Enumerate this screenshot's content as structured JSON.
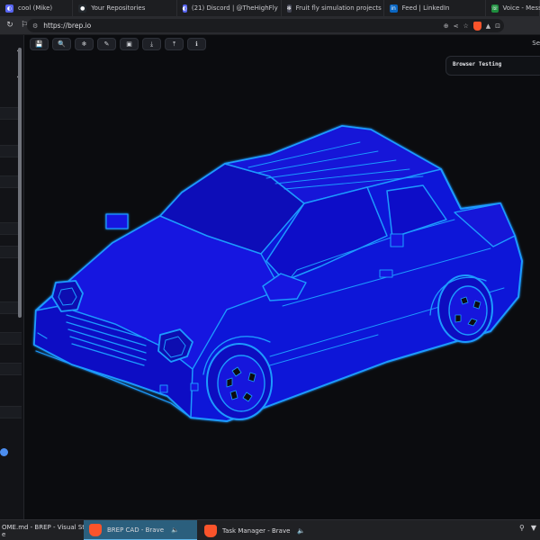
{
  "browser": {
    "tabs": [
      {
        "label": "cool (Mike)",
        "icon": "discord-icon",
        "color": "#5865f2"
      },
      {
        "label": "Your Repositories",
        "icon": "github-icon",
        "color": "#24292e"
      },
      {
        "label": "(21) Discord | @TheHighFly",
        "icon": "discord-icon",
        "color": "#5865f2"
      },
      {
        "label": "Fruit fly simulation projects",
        "icon": "chatgpt-icon",
        "color": "#444654"
      },
      {
        "label": "Feed | LinkedIn",
        "icon": "linkedin-icon",
        "color": "#0a66c2"
      },
      {
        "label": "Voice - Messages",
        "icon": "voice-icon",
        "color": "#1e8e3e"
      }
    ],
    "url": "https://brep.io"
  },
  "viewport": {
    "tools": [
      "save-icon",
      "search-icon",
      "snowflake-icon",
      "pencil-icon",
      "box-icon",
      "import-icon",
      "export-icon",
      "info-icon"
    ],
    "settings_fragment": "Se",
    "testing_card": "Browser Testing"
  },
  "taskbar": {
    "items": [
      {
        "label": "OME.md - BREP - Visual Studio",
        "sub": "e",
        "icon": "vscode-icon",
        "active": false
      },
      {
        "label": "BREP CAD - Brave",
        "icon": "brave-icon",
        "active": true
      },
      {
        "label": "Task Manager - Brave",
        "icon": "brave-icon",
        "active": false
      }
    ]
  },
  "colors": {
    "accent": "#1e9bff",
    "car_fill": "#0f12d8",
    "background": "#0b0c0f"
  }
}
